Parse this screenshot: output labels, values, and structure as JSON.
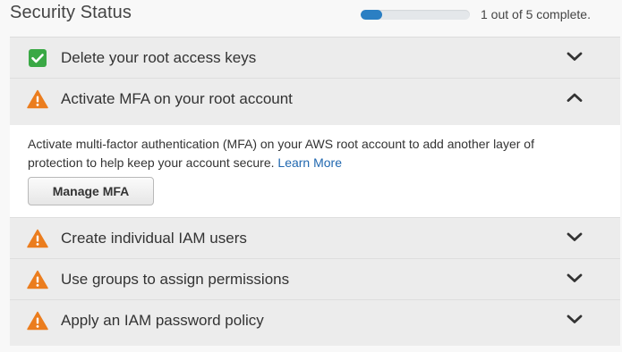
{
  "header": {
    "title": "Security Status",
    "progress_text": "1 out of 5 complete.",
    "progress_fraction": 0.2
  },
  "items": [
    {
      "label": "Delete your root access keys",
      "status": "complete",
      "icon": "check-icon",
      "expanded": false
    },
    {
      "label": "Activate MFA on your root account",
      "status": "warning",
      "icon": "warning-icon",
      "expanded": true
    },
    {
      "label": "Create individual IAM users",
      "status": "warning",
      "icon": "warning-icon",
      "expanded": false
    },
    {
      "label": "Use groups to assign permissions",
      "status": "warning",
      "icon": "warning-icon",
      "expanded": false
    },
    {
      "label": "Apply an IAM password policy",
      "status": "warning",
      "icon": "warning-icon",
      "expanded": false
    }
  ],
  "expanded_panel": {
    "description": "Activate multi-factor authentication (MFA) on your AWS root account to add another layer of protection to help keep your account secure.",
    "learn_more": "Learn More",
    "button_label": "Manage MFA"
  },
  "colors": {
    "check_green": "#3aa845",
    "warning_orange": "#eb7d1e",
    "progress_blue": "#2b7fc3",
    "link_blue": "#2168b0"
  }
}
